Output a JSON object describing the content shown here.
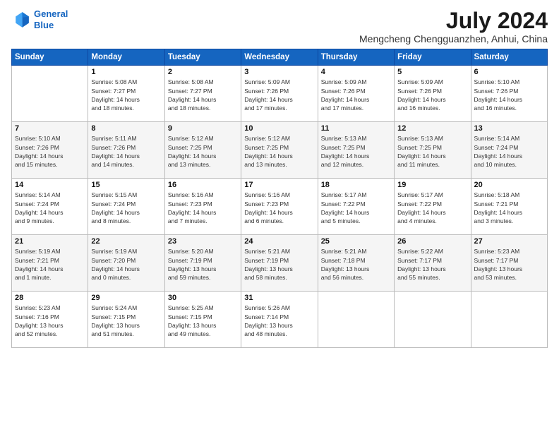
{
  "header": {
    "logo_line1": "General",
    "logo_line2": "Blue",
    "month_year": "July 2024",
    "location": "Mengcheng Chengguanzhen, Anhui, China"
  },
  "days_of_week": [
    "Sunday",
    "Monday",
    "Tuesday",
    "Wednesday",
    "Thursday",
    "Friday",
    "Saturday"
  ],
  "weeks": [
    [
      {
        "num": "",
        "info": ""
      },
      {
        "num": "1",
        "info": "Sunrise: 5:08 AM\nSunset: 7:27 PM\nDaylight: 14 hours\nand 18 minutes."
      },
      {
        "num": "2",
        "info": "Sunrise: 5:08 AM\nSunset: 7:27 PM\nDaylight: 14 hours\nand 18 minutes."
      },
      {
        "num": "3",
        "info": "Sunrise: 5:09 AM\nSunset: 7:26 PM\nDaylight: 14 hours\nand 17 minutes."
      },
      {
        "num": "4",
        "info": "Sunrise: 5:09 AM\nSunset: 7:26 PM\nDaylight: 14 hours\nand 17 minutes."
      },
      {
        "num": "5",
        "info": "Sunrise: 5:09 AM\nSunset: 7:26 PM\nDaylight: 14 hours\nand 16 minutes."
      },
      {
        "num": "6",
        "info": "Sunrise: 5:10 AM\nSunset: 7:26 PM\nDaylight: 14 hours\nand 16 minutes."
      }
    ],
    [
      {
        "num": "7",
        "info": "Sunrise: 5:10 AM\nSunset: 7:26 PM\nDaylight: 14 hours\nand 15 minutes."
      },
      {
        "num": "8",
        "info": "Sunrise: 5:11 AM\nSunset: 7:26 PM\nDaylight: 14 hours\nand 14 minutes."
      },
      {
        "num": "9",
        "info": "Sunrise: 5:12 AM\nSunset: 7:25 PM\nDaylight: 14 hours\nand 13 minutes."
      },
      {
        "num": "10",
        "info": "Sunrise: 5:12 AM\nSunset: 7:25 PM\nDaylight: 14 hours\nand 13 minutes."
      },
      {
        "num": "11",
        "info": "Sunrise: 5:13 AM\nSunset: 7:25 PM\nDaylight: 14 hours\nand 12 minutes."
      },
      {
        "num": "12",
        "info": "Sunrise: 5:13 AM\nSunset: 7:25 PM\nDaylight: 14 hours\nand 11 minutes."
      },
      {
        "num": "13",
        "info": "Sunrise: 5:14 AM\nSunset: 7:24 PM\nDaylight: 14 hours\nand 10 minutes."
      }
    ],
    [
      {
        "num": "14",
        "info": "Sunrise: 5:14 AM\nSunset: 7:24 PM\nDaylight: 14 hours\nand 9 minutes."
      },
      {
        "num": "15",
        "info": "Sunrise: 5:15 AM\nSunset: 7:24 PM\nDaylight: 14 hours\nand 8 minutes."
      },
      {
        "num": "16",
        "info": "Sunrise: 5:16 AM\nSunset: 7:23 PM\nDaylight: 14 hours\nand 7 minutes."
      },
      {
        "num": "17",
        "info": "Sunrise: 5:16 AM\nSunset: 7:23 PM\nDaylight: 14 hours\nand 6 minutes."
      },
      {
        "num": "18",
        "info": "Sunrise: 5:17 AM\nSunset: 7:22 PM\nDaylight: 14 hours\nand 5 minutes."
      },
      {
        "num": "19",
        "info": "Sunrise: 5:17 AM\nSunset: 7:22 PM\nDaylight: 14 hours\nand 4 minutes."
      },
      {
        "num": "20",
        "info": "Sunrise: 5:18 AM\nSunset: 7:21 PM\nDaylight: 14 hours\nand 3 minutes."
      }
    ],
    [
      {
        "num": "21",
        "info": "Sunrise: 5:19 AM\nSunset: 7:21 PM\nDaylight: 14 hours\nand 1 minute."
      },
      {
        "num": "22",
        "info": "Sunrise: 5:19 AM\nSunset: 7:20 PM\nDaylight: 14 hours\nand 0 minutes."
      },
      {
        "num": "23",
        "info": "Sunrise: 5:20 AM\nSunset: 7:19 PM\nDaylight: 13 hours\nand 59 minutes."
      },
      {
        "num": "24",
        "info": "Sunrise: 5:21 AM\nSunset: 7:19 PM\nDaylight: 13 hours\nand 58 minutes."
      },
      {
        "num": "25",
        "info": "Sunrise: 5:21 AM\nSunset: 7:18 PM\nDaylight: 13 hours\nand 56 minutes."
      },
      {
        "num": "26",
        "info": "Sunrise: 5:22 AM\nSunset: 7:17 PM\nDaylight: 13 hours\nand 55 minutes."
      },
      {
        "num": "27",
        "info": "Sunrise: 5:23 AM\nSunset: 7:17 PM\nDaylight: 13 hours\nand 53 minutes."
      }
    ],
    [
      {
        "num": "28",
        "info": "Sunrise: 5:23 AM\nSunset: 7:16 PM\nDaylight: 13 hours\nand 52 minutes."
      },
      {
        "num": "29",
        "info": "Sunrise: 5:24 AM\nSunset: 7:15 PM\nDaylight: 13 hours\nand 51 minutes."
      },
      {
        "num": "30",
        "info": "Sunrise: 5:25 AM\nSunset: 7:15 PM\nDaylight: 13 hours\nand 49 minutes."
      },
      {
        "num": "31",
        "info": "Sunrise: 5:26 AM\nSunset: 7:14 PM\nDaylight: 13 hours\nand 48 minutes."
      },
      {
        "num": "",
        "info": ""
      },
      {
        "num": "",
        "info": ""
      },
      {
        "num": "",
        "info": ""
      }
    ]
  ]
}
